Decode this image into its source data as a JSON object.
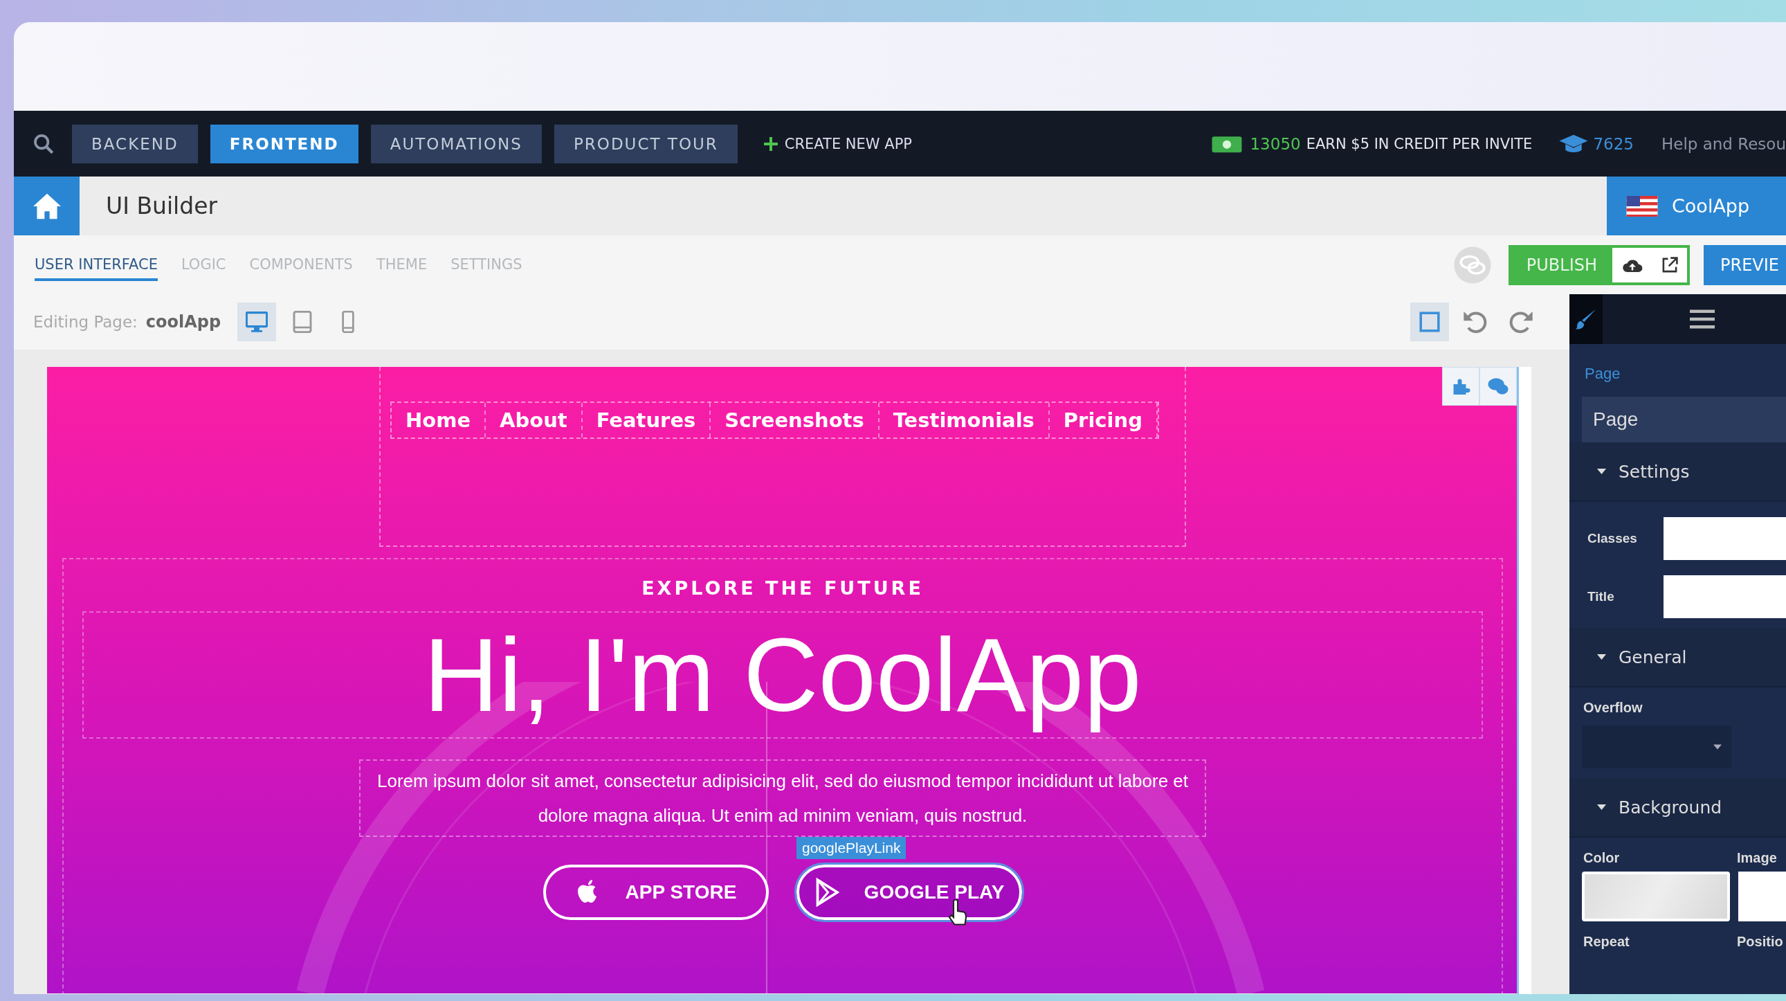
{
  "topbar": {
    "buttons": [
      {
        "label": "BACKEND",
        "selected": false
      },
      {
        "label": "FRONTEND",
        "selected": true
      },
      {
        "label": "AUTOMATIONS",
        "selected": false
      },
      {
        "label": "PRODUCT TOUR",
        "selected": false
      }
    ],
    "create_link": "CREATE NEW APP",
    "credit_count": "13050",
    "credit_text": "EARN $5 IN CREDIT PER INVITE",
    "learn_count": "7625",
    "help": "Help and Resou"
  },
  "header": {
    "title": "UI Builder",
    "app_name": "CoolApp"
  },
  "tabs": [
    {
      "label": "USER INTERFACE",
      "selected": true
    },
    {
      "label": "LOGIC",
      "selected": false
    },
    {
      "label": "COMPONENTS",
      "selected": false
    },
    {
      "label": "THEME",
      "selected": false
    },
    {
      "label": "SETTINGS",
      "selected": false
    }
  ],
  "actions": {
    "publish": "PUBLISH",
    "preview": "PREVIE"
  },
  "editing": {
    "label": "Editing Page:",
    "page": "coolApp",
    "devices": [
      {
        "kind": "desktop",
        "selected": true
      },
      {
        "kind": "tablet",
        "selected": false
      },
      {
        "kind": "phone",
        "selected": false
      }
    ]
  },
  "canvas": {
    "nav": [
      "Home",
      "About",
      "Features",
      "Screenshots",
      "Testimonials",
      "Pricing"
    ],
    "eyebrow": "EXPLORE THE FUTURE",
    "title": "Hi, I'm CoolApp",
    "text": "Lorem ipsum dolor sit amet, consectetur adipisicing elit, sed do eiusmod tempor incididunt ut labore et dolore magna aliqua. Ut enim ad minim veniam, quis nostrud.",
    "selection_label": "googlePlayLink",
    "buttons": [
      {
        "kind": "apple",
        "label": "APP STORE",
        "selected": false
      },
      {
        "kind": "play",
        "label": "GOOGLE PLAY",
        "selected": true
      }
    ]
  },
  "panel": {
    "tabs": [
      {
        "kind": "brush",
        "selected": true
      },
      {
        "kind": "menu",
        "selected": false
      }
    ],
    "breadcrumb": "Page",
    "element": "Page",
    "settings": {
      "title": "Settings",
      "fields": [
        "Classes",
        "Title"
      ]
    },
    "general": {
      "title": "General",
      "overflow_label": "Overflow"
    },
    "background": {
      "title": "Background",
      "color_label": "Color",
      "image_label": "Image",
      "repeat_label": "Repeat",
      "position_label": "Positio"
    }
  }
}
